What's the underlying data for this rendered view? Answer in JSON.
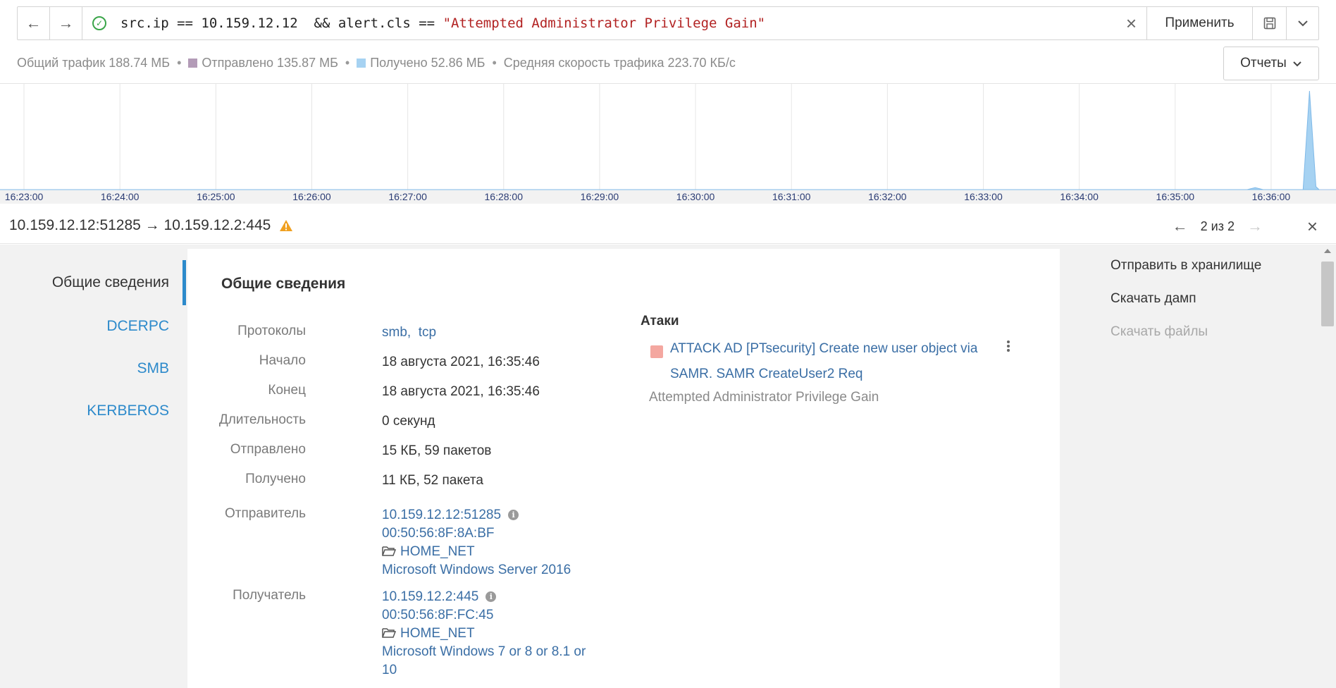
{
  "query": {
    "text_plain": "src.ip == 10.159.12.12  && alert.cls == ",
    "text_string": "\"Attempted Administrator Privilege Gain\"",
    "apply_label": "Применить"
  },
  "stats": {
    "total": "Общий трафик 188.74 МБ",
    "sent": "Отправлено 135.87 МБ",
    "received": "Получено 52.86 МБ",
    "avg_speed": "Средняя скорость трафика 223.70 КБ/с",
    "sent_color": "#b39bb7",
    "received_color": "#a6d2f2",
    "reports_label": "Отчеты"
  },
  "chart_data": {
    "type": "area",
    "x_ticks": [
      "16:23:00",
      "16:24:00",
      "16:25:00",
      "16:26:00",
      "16:27:00",
      "16:28:00",
      "16:29:00",
      "16:30:00",
      "16:31:00",
      "16:32:00",
      "16:33:00",
      "16:34:00",
      "16:35:00",
      "16:36:00"
    ],
    "series": [
      {
        "color": "#a6d2f2",
        "points": [
          [
            "16:22:45",
            0
          ],
          [
            "16:35:45",
            0
          ],
          [
            "16:35:50",
            0.02
          ],
          [
            "16:35:55",
            0
          ],
          [
            "16:36:20",
            0
          ],
          [
            "16:36:24",
            1.0
          ],
          [
            "16:36:28",
            0.03
          ],
          [
            "16:36:30",
            0
          ]
        ]
      }
    ],
    "grid": true,
    "xlim": [
      "16:22:45",
      "16:36:30"
    ]
  },
  "flow": {
    "title": "10.159.12.12:51285 → 10.159.12.2:445",
    "pager": "2 из 2"
  },
  "sidenav": [
    {
      "label": "Общие сведения"
    },
    {
      "label": "DCERPC"
    },
    {
      "label": "SMB"
    },
    {
      "label": "KERBEROS"
    }
  ],
  "card": {
    "title": "Общие сведения",
    "props": {
      "protocols_label": "Протоколы",
      "protocols": [
        "smb",
        "tcp"
      ],
      "start_label": "Начало",
      "start": "18 августа 2021, 16:35:46",
      "end_label": "Конец",
      "end": "18 августа 2021, 16:35:46",
      "duration_label": "Длительность",
      "duration": "0 секунд",
      "sent_label": "Отправлено",
      "sent": "15 КБ, 59 пакетов",
      "received_label": "Получено",
      "received": "11 КБ, 52 пакета",
      "sender_label": "Отправитель",
      "sender_addr": "10.159.12.12:51285",
      "sender_mac": "00:50:56:8F:8A:BF",
      "sender_net": "HOME_NET",
      "sender_os": "Microsoft Windows Server 2016",
      "receiver_label": "Получатель",
      "receiver_addr": "10.159.12.2:445",
      "receiver_mac": "00:50:56:8F:FC:45",
      "receiver_net": "HOME_NET",
      "receiver_os_line1": "Microsoft Windows 7 or 8 or 8.1 or",
      "receiver_os_line2": "10"
    },
    "attacks": {
      "title": "Атаки",
      "items": [
        {
          "name": "ATTACK AD [PTsecurity] Create new user object via SAMR. SAMR CreateUser2 Req",
          "cls": "Attempted Administrator Privilege Gain",
          "color": "#f4a7a0"
        }
      ]
    }
  },
  "actions": [
    {
      "label": "Отправить в хранилище"
    },
    {
      "label": "Скачать дамп"
    },
    {
      "label": "Скачать файлы"
    }
  ]
}
